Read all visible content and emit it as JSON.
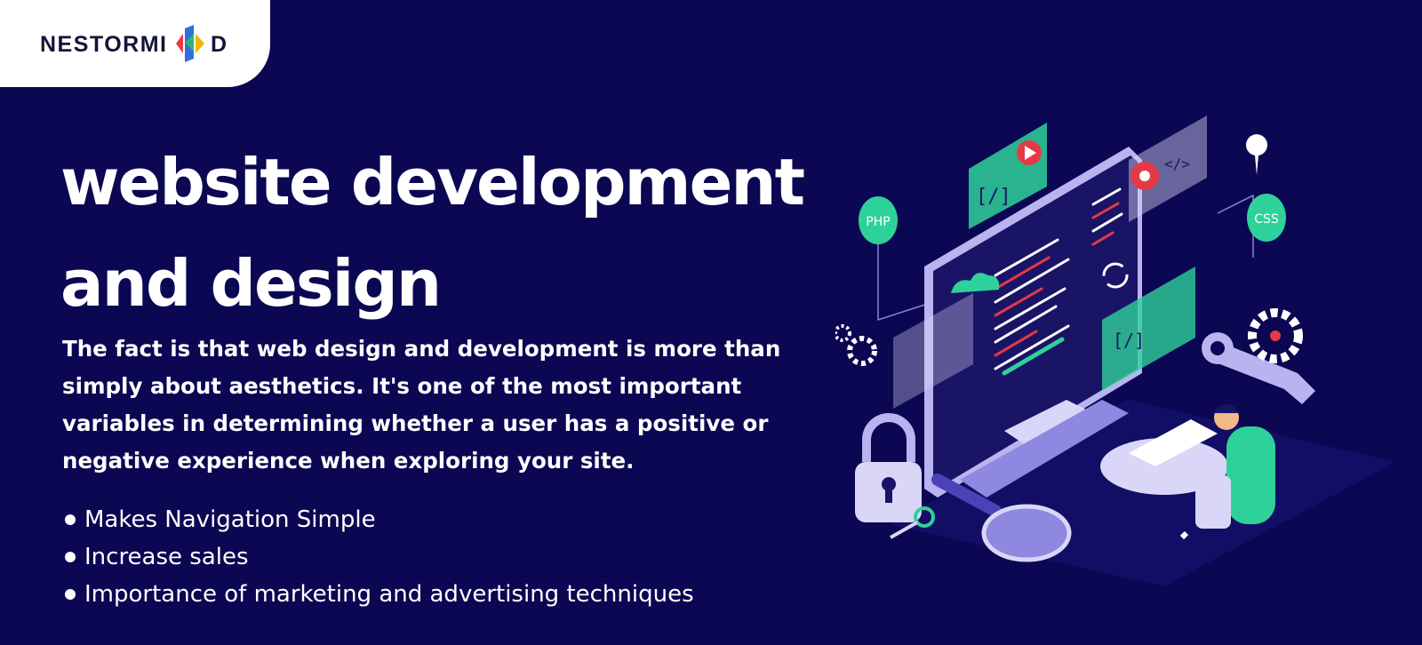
{
  "brand": {
    "name_prefix": "NESTORMI",
    "name_suffix": "D"
  },
  "headline": "website development and design",
  "body": "The fact is that web design and development is more than simply about aesthetics. It's one of the most important variables in determining whether a user has a positive or negative experience when exploring your site.",
  "bullets": [
    "Makes Navigation Simple",
    "Increase sales",
    "Importance of marketing and advertising techniques"
  ],
  "illustration": {
    "badges": [
      "PHP",
      "CSS"
    ],
    "code_tags": [
      "[/]",
      "</>"
    ]
  },
  "colors": {
    "background": "#0b0752",
    "text": "#ffffff",
    "accent_green": "#2fd19a",
    "accent_purple": "#b9b4f0",
    "accent_red": "#d4213a"
  }
}
